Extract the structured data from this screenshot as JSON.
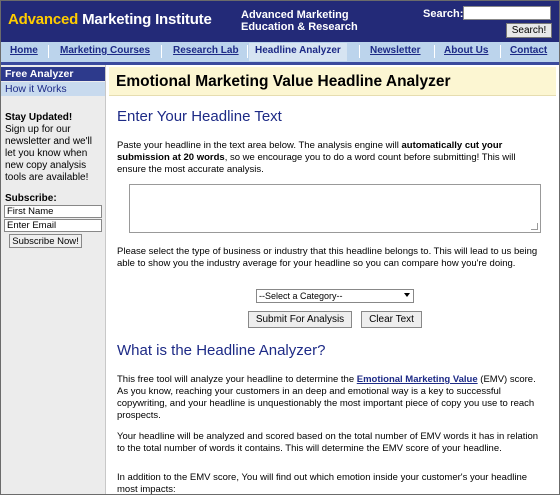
{
  "header": {
    "logo_brand": "Advanced ",
    "logo_rest": "Marketing Institute",
    "tagline_line1": "Advanced Marketing",
    "tagline_line2": "Education & Research",
    "search_label": "Search:",
    "search_value": "",
    "search_button": "Search!"
  },
  "nav": {
    "items": [
      "Home",
      "Marketing Courses",
      "Research Lab",
      "Headline Analyzer",
      "Newsletter",
      "About Us",
      "Contact"
    ],
    "active": "Headline Analyzer"
  },
  "sidebar": {
    "active_item": "Free Analyzer",
    "link_item": "How it Works",
    "stay_title": "Stay Updated!",
    "stay_text": "Sign up for our newsletter and we'll let you know when new copy analysis tools are available!",
    "subscribe_title": "Subscribe:",
    "first_name_value": "First Name",
    "email_value": "Enter Email",
    "subscribe_button": "Subscribe Now!"
  },
  "main": {
    "title": "Emotional Marketing Value Headline Analyzer",
    "enter_heading": "Enter Your Headline Text",
    "intro_part1": "Paste your headline in the text area below. The analysis engine will ",
    "intro_bold": "automatically cut your submission at 20 words",
    "intro_part2": ", so we encourage you to do a word count before submitting! This will ensure the most accurate analysis.",
    "headline_value": "",
    "category_text": "Please select the type of business or industry that this headline belongs to. This will lead to us being able to show you the industry average for your headline so you can compare how you're doing.",
    "category_selected": "--Select a Category--",
    "submit_button": "Submit For Analysis",
    "clear_button": "Clear Text",
    "what_heading": "What is the Headline Analyzer?",
    "what_p1_part1": "This free tool will analyze your headline to determine the ",
    "what_p1_link": "Emotional Marketing Value",
    "what_p1_part2": " (EMV) score. As you know, reaching your customers in an deep and emotional way is a key to successful copywriting, and your headline is unquestionably the most important piece of copy you use to reach prospects.",
    "what_p2": "Your headline will be analyzed and scored based on the total number of EMV words it has in relation to the total number of words it contains. This will determine the EMV score of your headline.",
    "what_p3": "In addition to the EMV score, You will find out which emotion inside your customer's your headline most impacts:"
  }
}
